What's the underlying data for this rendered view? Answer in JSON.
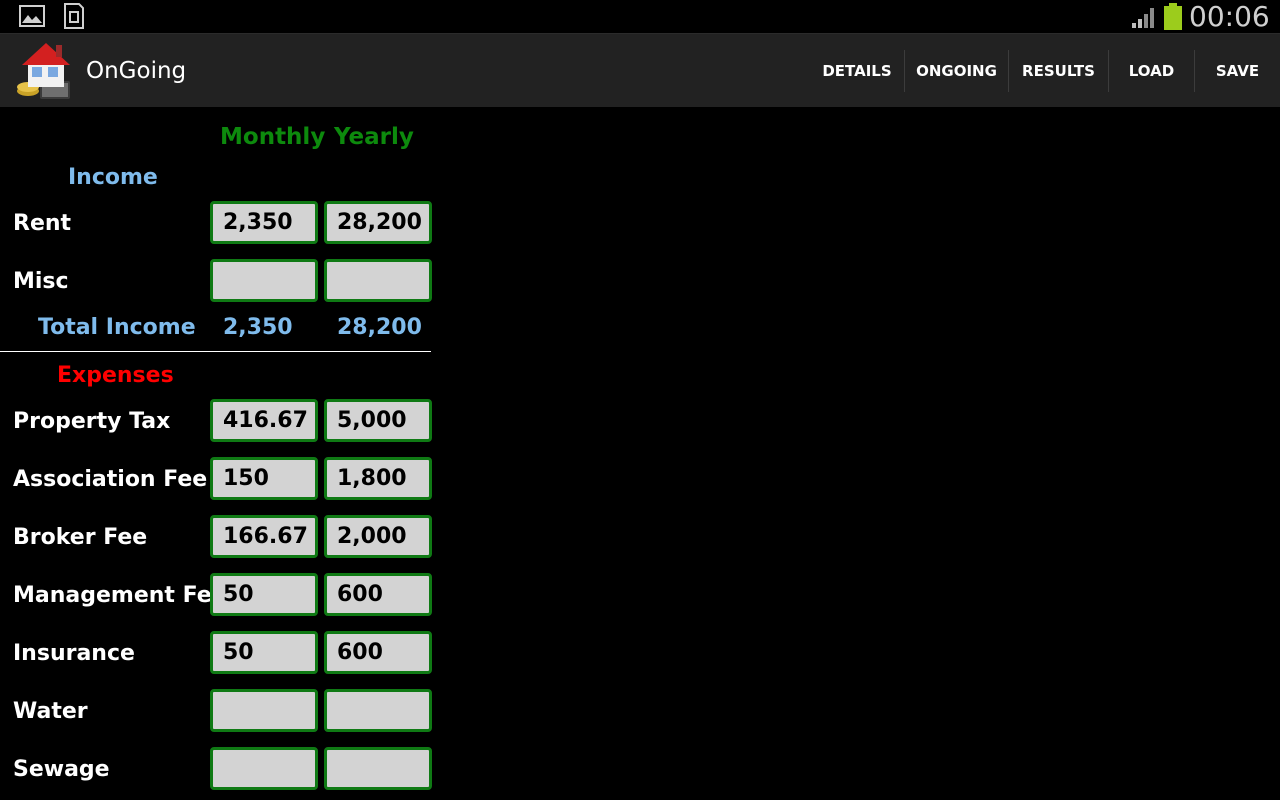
{
  "status_bar": {
    "time": "00:06",
    "icons": [
      "gallery-icon",
      "sd-card-icon",
      "signal-icon",
      "battery-icon"
    ]
  },
  "action_bar": {
    "title": "OnGoing",
    "buttons": [
      "DETAILS",
      "ONGOING",
      "RESULTS",
      "LOAD",
      "SAVE"
    ]
  },
  "columns": {
    "monthly": "Monthly",
    "yearly": "Yearly"
  },
  "income": {
    "heading": "Income",
    "rows": [
      {
        "label": "Rent",
        "monthly": "2,350",
        "yearly": "28,200"
      },
      {
        "label": "Misc",
        "monthly": "",
        "yearly": ""
      }
    ],
    "total": {
      "label": "Total Income",
      "monthly": "2,350",
      "yearly": "28,200"
    }
  },
  "expenses": {
    "heading": "Expenses",
    "rows": [
      {
        "label": "Property Tax",
        "monthly": "416.67",
        "yearly": "5,000"
      },
      {
        "label": "Association Fee",
        "monthly": "150",
        "yearly": "1,800"
      },
      {
        "label": "Broker Fee",
        "monthly": "166.67",
        "yearly": "2,000"
      },
      {
        "label": "Management Fee",
        "monthly": "50",
        "yearly": "600"
      },
      {
        "label": "Insurance",
        "monthly": "50",
        "yearly": "600"
      },
      {
        "label": "Water",
        "monthly": "",
        "yearly": ""
      },
      {
        "label": "Sewage",
        "monthly": "",
        "yearly": ""
      }
    ]
  },
  "colors": {
    "column_heading": "#0d8a0d",
    "income_heading": "#7fbbec",
    "expenses_heading": "#ff0000",
    "field_border": "#0f7a14",
    "field_background": "#d3d3d3",
    "action_bar": "#222222"
  }
}
